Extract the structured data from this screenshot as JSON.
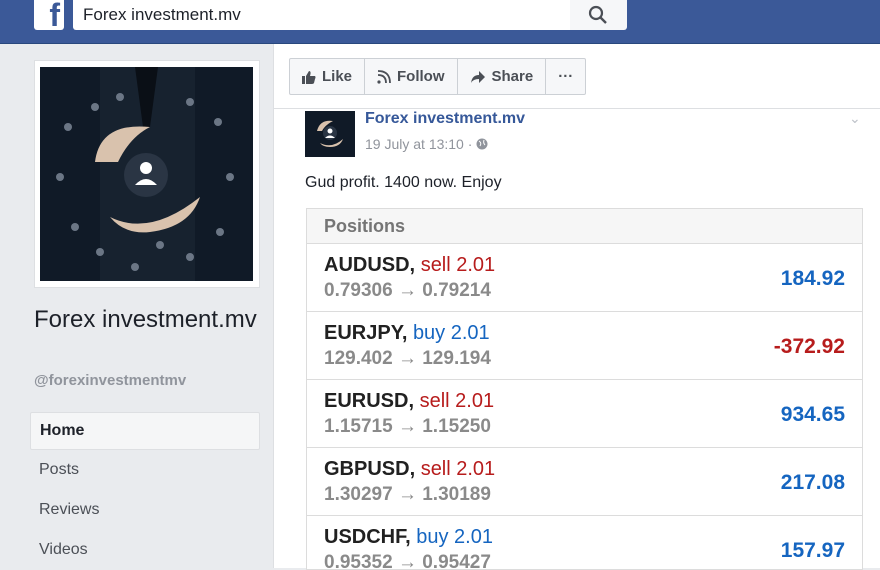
{
  "topbar": {
    "logo_letter": "f",
    "search_value": "Forex investment.mv"
  },
  "page": {
    "name": "Forex investment.mv",
    "handle": "@forexinvestmentmv"
  },
  "nav": [
    {
      "label": "Home",
      "active": true
    },
    {
      "label": "Posts",
      "active": false
    },
    {
      "label": "Reviews",
      "active": false
    },
    {
      "label": "Videos",
      "active": false
    }
  ],
  "actions": {
    "like": "Like",
    "follow": "Follow",
    "share": "Share",
    "more": "···"
  },
  "post": {
    "author": "Forex investment.mv",
    "time": "19 July at 13:10 ·",
    "text": "Gud profit. 1400 now. Enjoy",
    "positions_title": "Positions",
    "rows": [
      {
        "pair": "AUDUSD,",
        "side": "sell 2.01",
        "side_type": "sell",
        "prices": "0.79306 → 0.79214",
        "pl": "184.92",
        "pl_color": "#1565c0"
      },
      {
        "pair": "EURJPY,",
        "side": "buy 2.01",
        "side_type": "buy",
        "prices": "129.402 → 129.194",
        "pl": "-372.92",
        "pl_color": "#b71c1c"
      },
      {
        "pair": "EURUSD,",
        "side": "sell 2.01",
        "side_type": "sell",
        "prices": "1.15715 → 1.15250",
        "pl": "934.65",
        "pl_color": "#1565c0"
      },
      {
        "pair": "GBPUSD,",
        "side": "sell 2.01",
        "side_type": "sell",
        "prices": "1.30297 → 1.30189",
        "pl": "217.08",
        "pl_color": "#1565c0"
      },
      {
        "pair": "USDCHF,",
        "side": "buy 2.01",
        "side_type": "buy",
        "prices": "0.95352 → 0.95427",
        "pl": "157.97",
        "pl_color": "#1565c0"
      }
    ]
  },
  "colors": {
    "brand": "#3b5998",
    "link": "#365899",
    "sell": "#b71c1c",
    "buy": "#1565c0"
  }
}
